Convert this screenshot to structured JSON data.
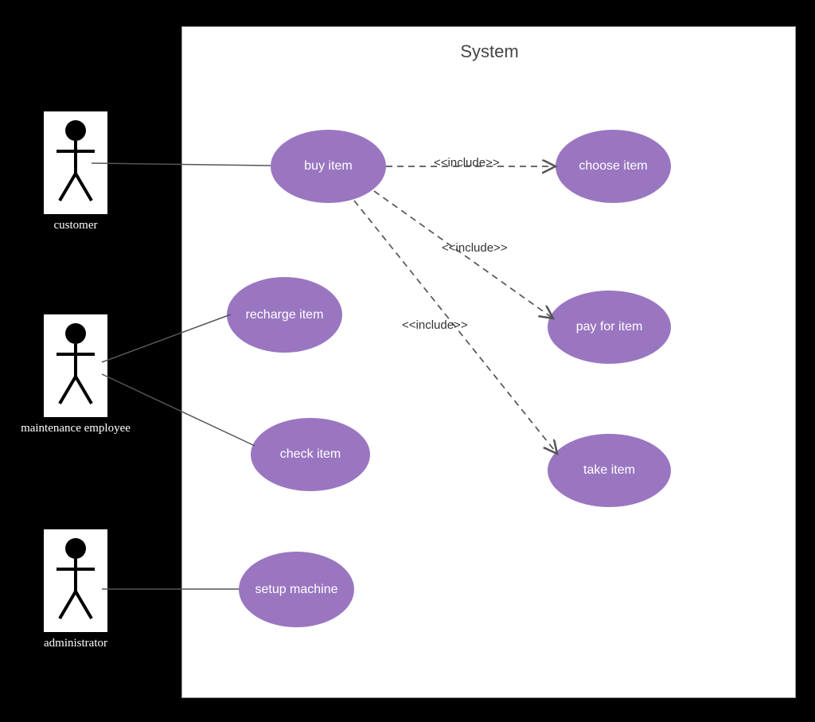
{
  "system": {
    "title": "System"
  },
  "actors": {
    "customer": "customer",
    "maintenance": "maintenance employee",
    "administrator": "administrator"
  },
  "usecases": {
    "buy": "buy item",
    "choose": "choose item",
    "pay": "pay for item",
    "take": "take item",
    "recharge": "recharge item",
    "check": "check item",
    "setup": "setup machine"
  },
  "relations": {
    "include1": "<<include>>",
    "include2": "<<include>>",
    "include3": "<<include>>"
  }
}
